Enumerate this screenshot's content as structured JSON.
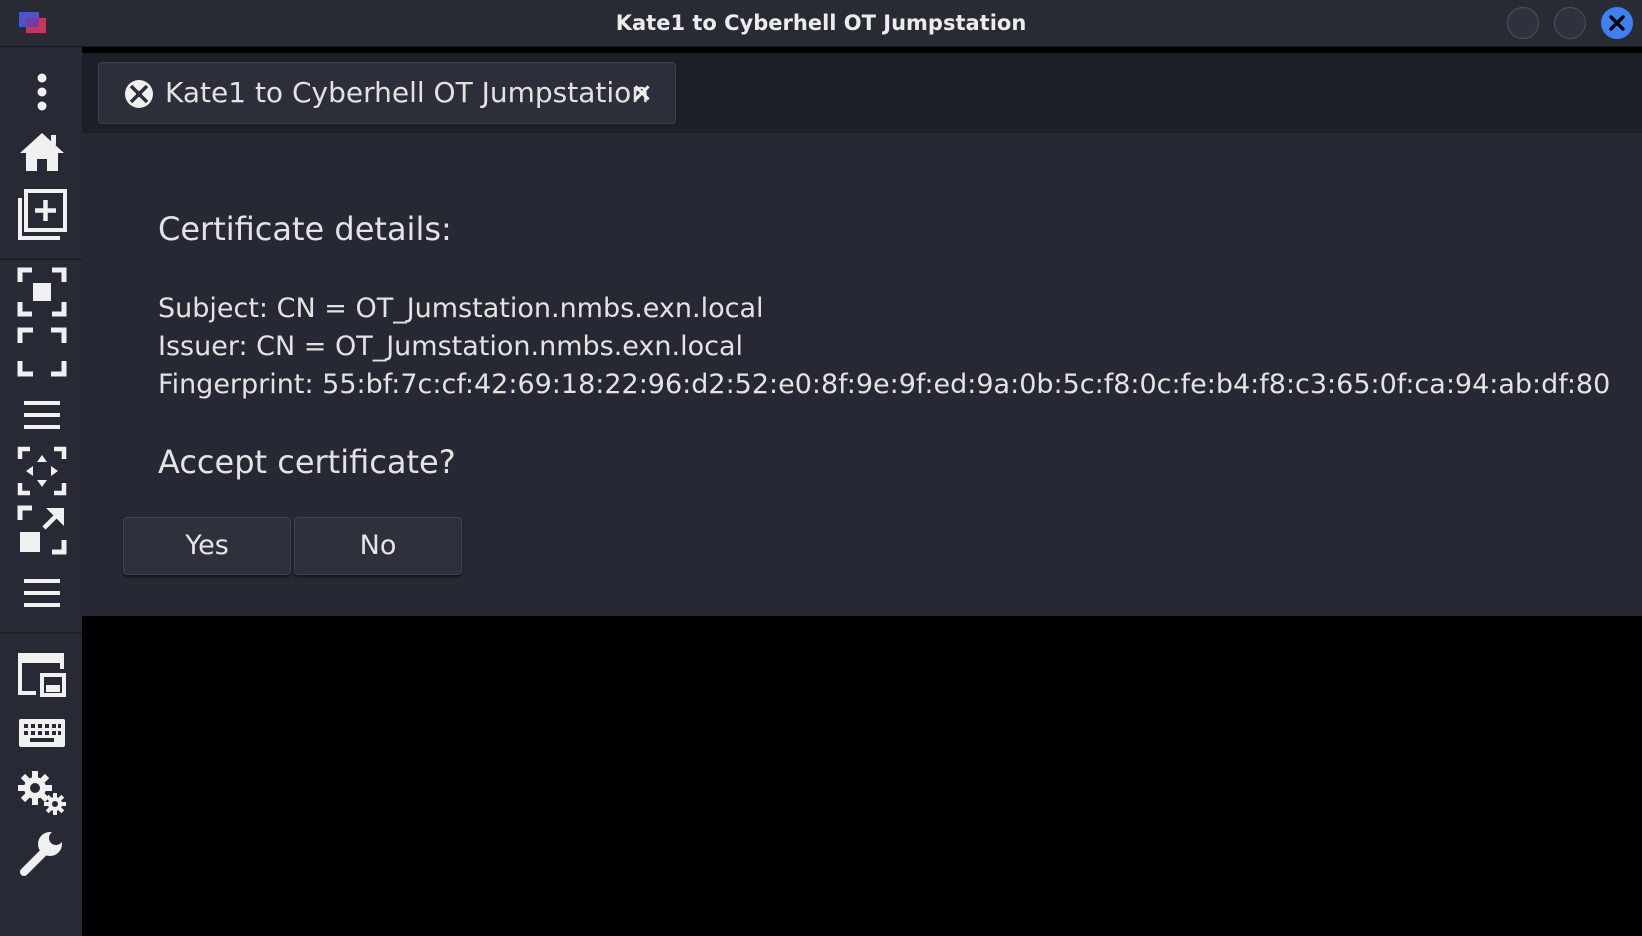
{
  "window": {
    "title": "Kate1 to Cyberhell OT Jumpstation",
    "close_label": "×"
  },
  "colors": {
    "titlebar_bg": "#282a34",
    "sidebar_bg": "#272a34",
    "dialog_bg": "#262933",
    "close_accent": "#3f7ff0",
    "remote_bg": "#000000"
  },
  "sidebar": {
    "items": [
      {
        "icon": "kebab-menu-icon"
      },
      {
        "icon": "home-icon"
      },
      {
        "icon": "new-tab-icon"
      },
      {
        "icon": "fit-window-icon"
      },
      {
        "icon": "fullscreen-icon"
      },
      {
        "icon": "menu-lines-icon"
      },
      {
        "icon": "scale-icon"
      },
      {
        "icon": "resize-window-icon"
      },
      {
        "icon": "menu-lines-icon"
      },
      {
        "icon": "display-window-icon"
      },
      {
        "icon": "keyboard-icon"
      },
      {
        "icon": "settings-gears-icon"
      },
      {
        "icon": "wrench-icon"
      }
    ]
  },
  "tabs": [
    {
      "label": "Kate1 to Cyberhell OT Jumpstation",
      "close": "×",
      "icon": "remote-connection-icon",
      "active": true
    }
  ],
  "dialog": {
    "heading": "Certificate details:",
    "subject": "Subject: CN = OT_Jumstation.nmbs.exn.local",
    "issuer": "Issuer: CN = OT_Jumstation.nmbs.exn.local",
    "fingerprint": "Fingerprint: 55:bf:7c:cf:42:69:18:22:96:d2:52:e0:8f:9e:9f:ed:9a:0b:5c:f8:0c:fe:b4:f8:c3:65:0f:ca:94:ab:df:80",
    "question": "Accept certificate?",
    "yes_label": "Yes",
    "no_label": "No"
  }
}
